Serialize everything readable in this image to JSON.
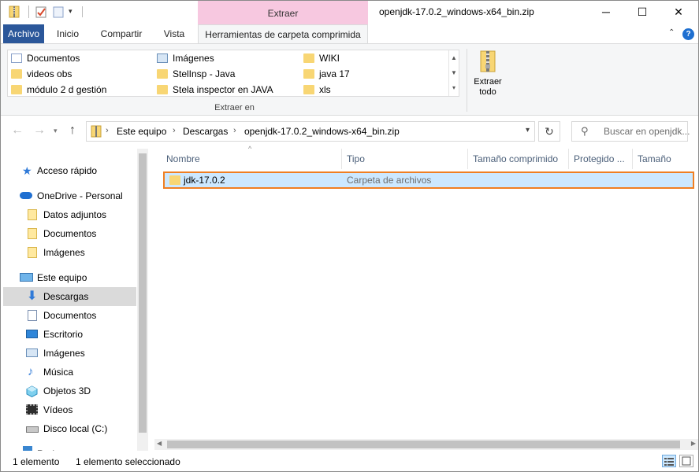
{
  "window": {
    "title": "openjdk-17.0.2_windows-x64_bin.zip",
    "context_tab": "Extraer",
    "minimize": "─",
    "maximize": "☐",
    "close": "✕"
  },
  "ribbon_tabs": {
    "archivo": "Archivo",
    "inicio": "Inicio",
    "compartir": "Compartir",
    "vista": "Vista",
    "herramientas": "Herramientas de carpeta comprimida",
    "help": "?"
  },
  "extract_to": {
    "items": [
      {
        "label": "Documentos",
        "icon": "documents-icon"
      },
      {
        "label": "videos obs",
        "icon": "folder-icon"
      },
      {
        "label": "módulo 2 d gestión",
        "icon": "folder-icon"
      },
      {
        "label": "Imágenes",
        "icon": "pictures-icon"
      },
      {
        "label": "StelInsp - Java",
        "icon": "folder-icon"
      },
      {
        "label": "Stela inspector en JAVA",
        "icon": "folder-icon"
      },
      {
        "label": "WIKI",
        "icon": "folder-icon"
      },
      {
        "label": "java 17",
        "icon": "folder-icon"
      },
      {
        "label": "xls",
        "icon": "folder-icon"
      }
    ],
    "group_label": "Extraer en",
    "extract_all_label_1": "Extraer",
    "extract_all_label_2": "todo"
  },
  "address": {
    "crumbs": [
      "Este equipo",
      "Descargas",
      "openjdk-17.0.2_windows-x64_bin.zip"
    ],
    "search_placeholder": "Buscar en openjdk..."
  },
  "nav_pane": {
    "items": [
      {
        "label": "Acceso rápido",
        "icon": "star-icon"
      },
      {
        "label": "OneDrive - Personal",
        "icon": "cloud-icon"
      },
      {
        "label": "Datos adjuntos",
        "icon": "folder-icon"
      },
      {
        "label": "Documentos",
        "icon": "folder-icon"
      },
      {
        "label": "Imágenes",
        "icon": "folder-icon"
      },
      {
        "label": "Este equipo",
        "icon": "computer-icon"
      },
      {
        "label": "Descargas",
        "icon": "download-icon"
      },
      {
        "label": "Documentos",
        "icon": "documents-icon"
      },
      {
        "label": "Escritorio",
        "icon": "desktop-icon"
      },
      {
        "label": "Imágenes",
        "icon": "pictures-icon"
      },
      {
        "label": "Música",
        "icon": "music-icon"
      },
      {
        "label": "Objetos 3D",
        "icon": "cube-icon"
      },
      {
        "label": "Vídeos",
        "icon": "video-icon"
      },
      {
        "label": "Disco local (C:)",
        "icon": "drive-icon"
      },
      {
        "label": "Red",
        "icon": "network-icon"
      }
    ],
    "selected": "Descargas"
  },
  "columns": [
    "Nombre",
    "Tipo",
    "Tamaño comprimido",
    "Protegido ...",
    "Tamaño"
  ],
  "files": [
    {
      "name": "jdk-17.0.2",
      "type": "Carpeta de archivos"
    }
  ],
  "status": {
    "count": "1 elemento",
    "selected": "1 elemento seleccionado"
  },
  "colors": {
    "accent": "#2b579a",
    "context_tab": "#f7c8e0",
    "selection": "#cce8ff",
    "highlight_border": "#f07f22"
  }
}
